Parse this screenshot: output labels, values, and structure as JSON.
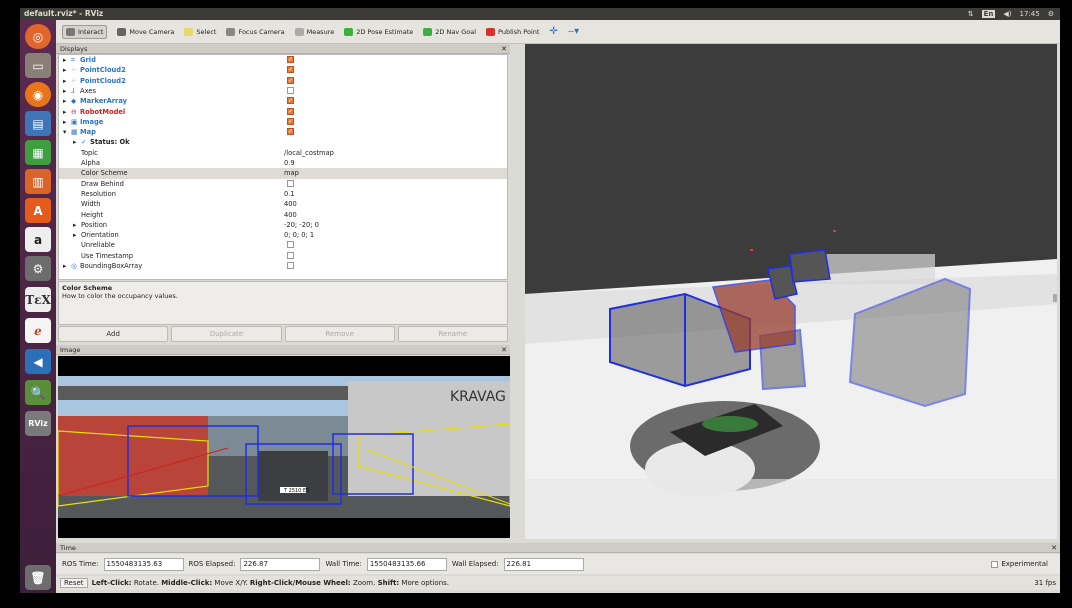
{
  "window": {
    "title": "default.rviz* - RViz"
  },
  "tray": {
    "lang": "En",
    "time": "17:45"
  },
  "toolbar": {
    "tools": [
      {
        "label": "Interact",
        "active": true,
        "color": "#777"
      },
      {
        "label": "Move Camera",
        "color": "#666"
      },
      {
        "label": "Select",
        "color": "#e9d66b"
      },
      {
        "label": "Focus Camera",
        "color": "#888"
      },
      {
        "label": "Measure",
        "color": "#aaa"
      },
      {
        "label": "2D Pose Estimate",
        "color": "#3bb33b"
      },
      {
        "label": "2D Nav Goal",
        "color": "#3bb33b"
      },
      {
        "label": "Publish Point",
        "color": "#d9302a"
      }
    ]
  },
  "displays": {
    "title": "Displays",
    "rows": [
      {
        "name": "Grid",
        "style": "blue",
        "indent": 0,
        "arrow": "▸",
        "icon": "⌗",
        "check": true
      },
      {
        "name": "PointCloud2",
        "style": "blue",
        "indent": 0,
        "arrow": "▸",
        "icon": "⁘",
        "check": true
      },
      {
        "name": "PointCloud2",
        "style": "blue",
        "indent": 0,
        "arrow": "▸",
        "icon": "⁘",
        "check": true
      },
      {
        "name": "Axes",
        "style": "",
        "indent": 0,
        "arrow": "▸",
        "icon": "⅃",
        "check": false
      },
      {
        "name": "MarkerArray",
        "style": "blue",
        "indent": 0,
        "arrow": "▸",
        "icon": "◆",
        "check": true
      },
      {
        "name": "RobotModel",
        "style": "red",
        "indent": 0,
        "arrow": "▸",
        "icon": "⊖",
        "check": true
      },
      {
        "name": "Image",
        "style": "blue",
        "indent": 0,
        "arrow": "▸",
        "icon": "▣",
        "check": true
      },
      {
        "name": "Map",
        "style": "blue",
        "indent": 0,
        "arrow": "▾",
        "icon": "▦",
        "check": true
      },
      {
        "name": "Status: Ok",
        "style": "bold",
        "indent": 1,
        "arrow": "▸",
        "icon": "✓"
      },
      {
        "name": "Topic",
        "indent": 2,
        "value": "/local_costmap"
      },
      {
        "name": "Alpha",
        "indent": 2,
        "value": "0.9"
      },
      {
        "name": "Color Scheme",
        "indent": 2,
        "value": "map",
        "selected": true
      },
      {
        "name": "Draw Behind",
        "indent": 2,
        "check": false
      },
      {
        "name": "Resolution",
        "indent": 2,
        "value": "0.1"
      },
      {
        "name": "Width",
        "indent": 2,
        "value": "400"
      },
      {
        "name": "Height",
        "indent": 2,
        "value": "400"
      },
      {
        "name": "Position",
        "indent": 1,
        "arrow": "▸",
        "value": "-20; -20; 0"
      },
      {
        "name": "Orientation",
        "indent": 1,
        "arrow": "▸",
        "value": "0; 0; 0; 1"
      },
      {
        "name": "Unreliable",
        "indent": 2,
        "check": false
      },
      {
        "name": "Use Timestamp",
        "indent": 2,
        "check": false
      },
      {
        "name": "BoundingBoxArray",
        "style": "",
        "indent": 0,
        "arrow": "▸",
        "icon": "◎",
        "check": false
      }
    ]
  },
  "description": {
    "title": "Color Scheme",
    "text": "How to color the occupancy values."
  },
  "buttons": {
    "add": "Add",
    "duplicate": "Duplicate",
    "remove": "Remove",
    "rename": "Rename"
  },
  "image_panel": {
    "title": "Image",
    "sign_text": "KRAVAG",
    "plate_text": "T 2510 ES"
  },
  "time": {
    "title": "Time",
    "ros_time_label": "ROS Time:",
    "ros_time": "1550483135.63",
    "ros_elapsed_label": "ROS Elapsed:",
    "ros_elapsed": "226.87",
    "wall_time_label": "Wall Time:",
    "wall_time": "1550483135.66",
    "wall_elapsed_label": "Wall Elapsed:",
    "wall_elapsed": "226.81",
    "experimental": "Experimental"
  },
  "status": {
    "reset": "Reset",
    "left": "Left-Click:",
    "left_t": " Rotate. ",
    "middle": "Middle-Click:",
    "middle_t": " Move X/Y. ",
    "right": "Right-Click/Mouse Wheel:",
    "right_t": " Zoom. ",
    "shift": "Shift:",
    "shift_t": " More options.",
    "fps": "31 fps"
  }
}
